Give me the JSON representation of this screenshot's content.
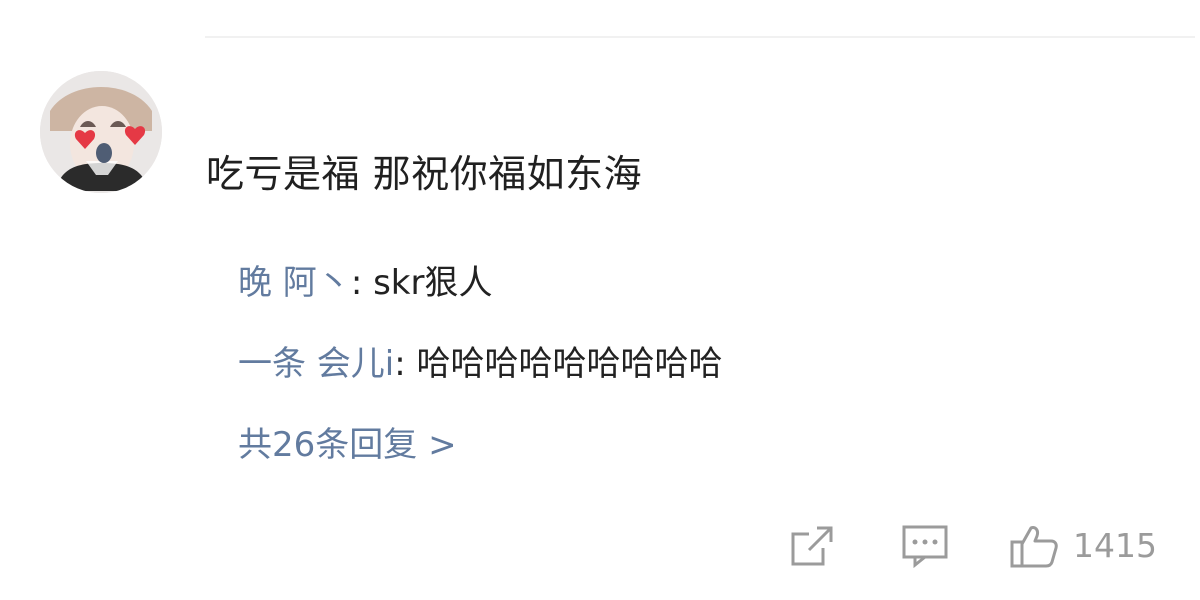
{
  "comment": {
    "text": "吃亏是福 那祝你福如东海"
  },
  "replies": [
    {
      "user": "晚 阿丶",
      "text": ": skr狠人"
    },
    {
      "user": "一条 会儿i",
      "text": ": 哈哈哈哈哈哈哈哈哈"
    }
  ],
  "reply_count_label": "共26条回复 >",
  "actions": {
    "like_count": "1415",
    "icons": [
      "share-icon",
      "comment-icon",
      "like-icon"
    ]
  },
  "colors": {
    "link": "#3b5b88",
    "icon_gray": "#9b9b9b",
    "text": "#202020"
  }
}
